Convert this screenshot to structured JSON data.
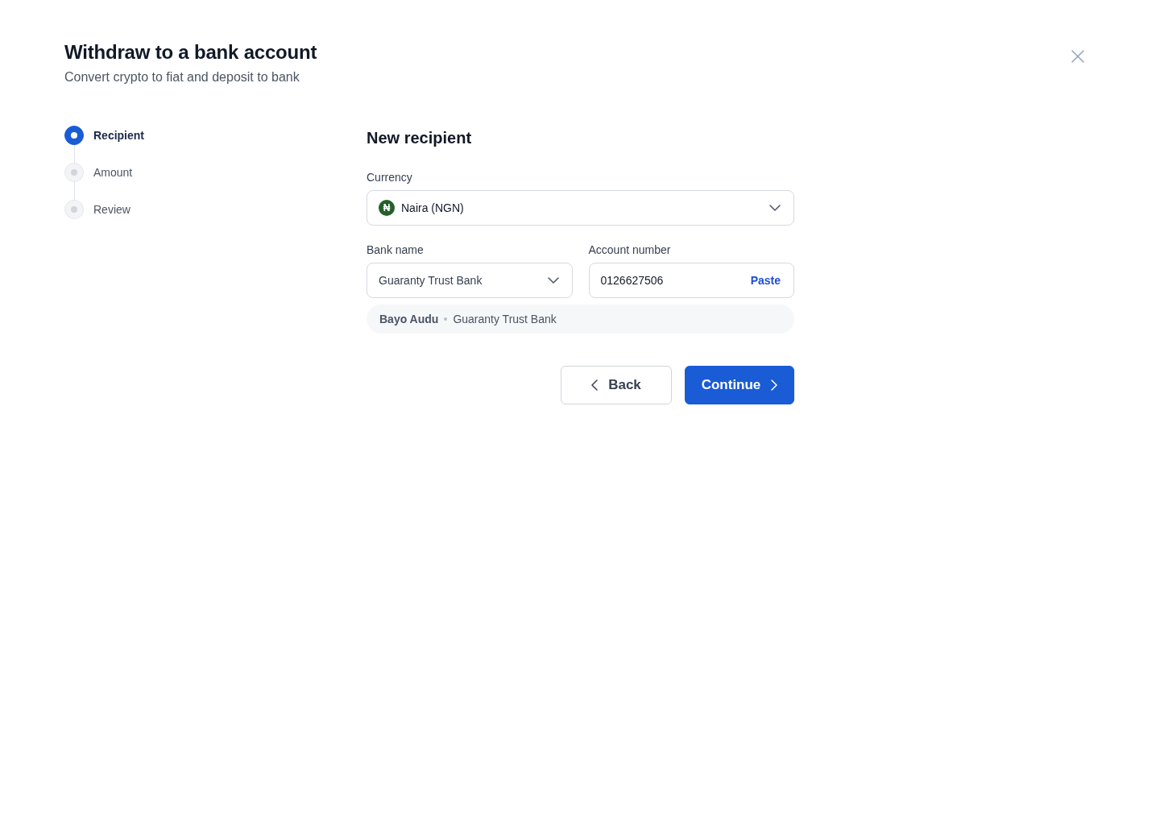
{
  "dialog": {
    "title": "Withdraw to a bank account",
    "subtitle": "Convert crypto to fiat and deposit to bank"
  },
  "steps": [
    {
      "label": "Recipient",
      "selected": true
    },
    {
      "label": "Amount",
      "selected": false
    },
    {
      "label": "Review",
      "selected": false
    }
  ],
  "form": {
    "heading": "New recipient",
    "currency": {
      "label": "Currency",
      "symbol": "₦",
      "color": "#25602a",
      "value": "Naira (NGN)"
    },
    "bank": {
      "label": "Bank name",
      "value": "Guaranty Trust Bank"
    },
    "account": {
      "label": "Account number",
      "value": "0126627506",
      "action": "Paste"
    },
    "resolved": {
      "name": "Bayo Audu",
      "bank": "Guaranty Trust Bank"
    }
  },
  "buttons": [
    {
      "label": "Back",
      "kind": "secondary"
    },
    {
      "label": "Continue",
      "kind": "primary"
    }
  ]
}
